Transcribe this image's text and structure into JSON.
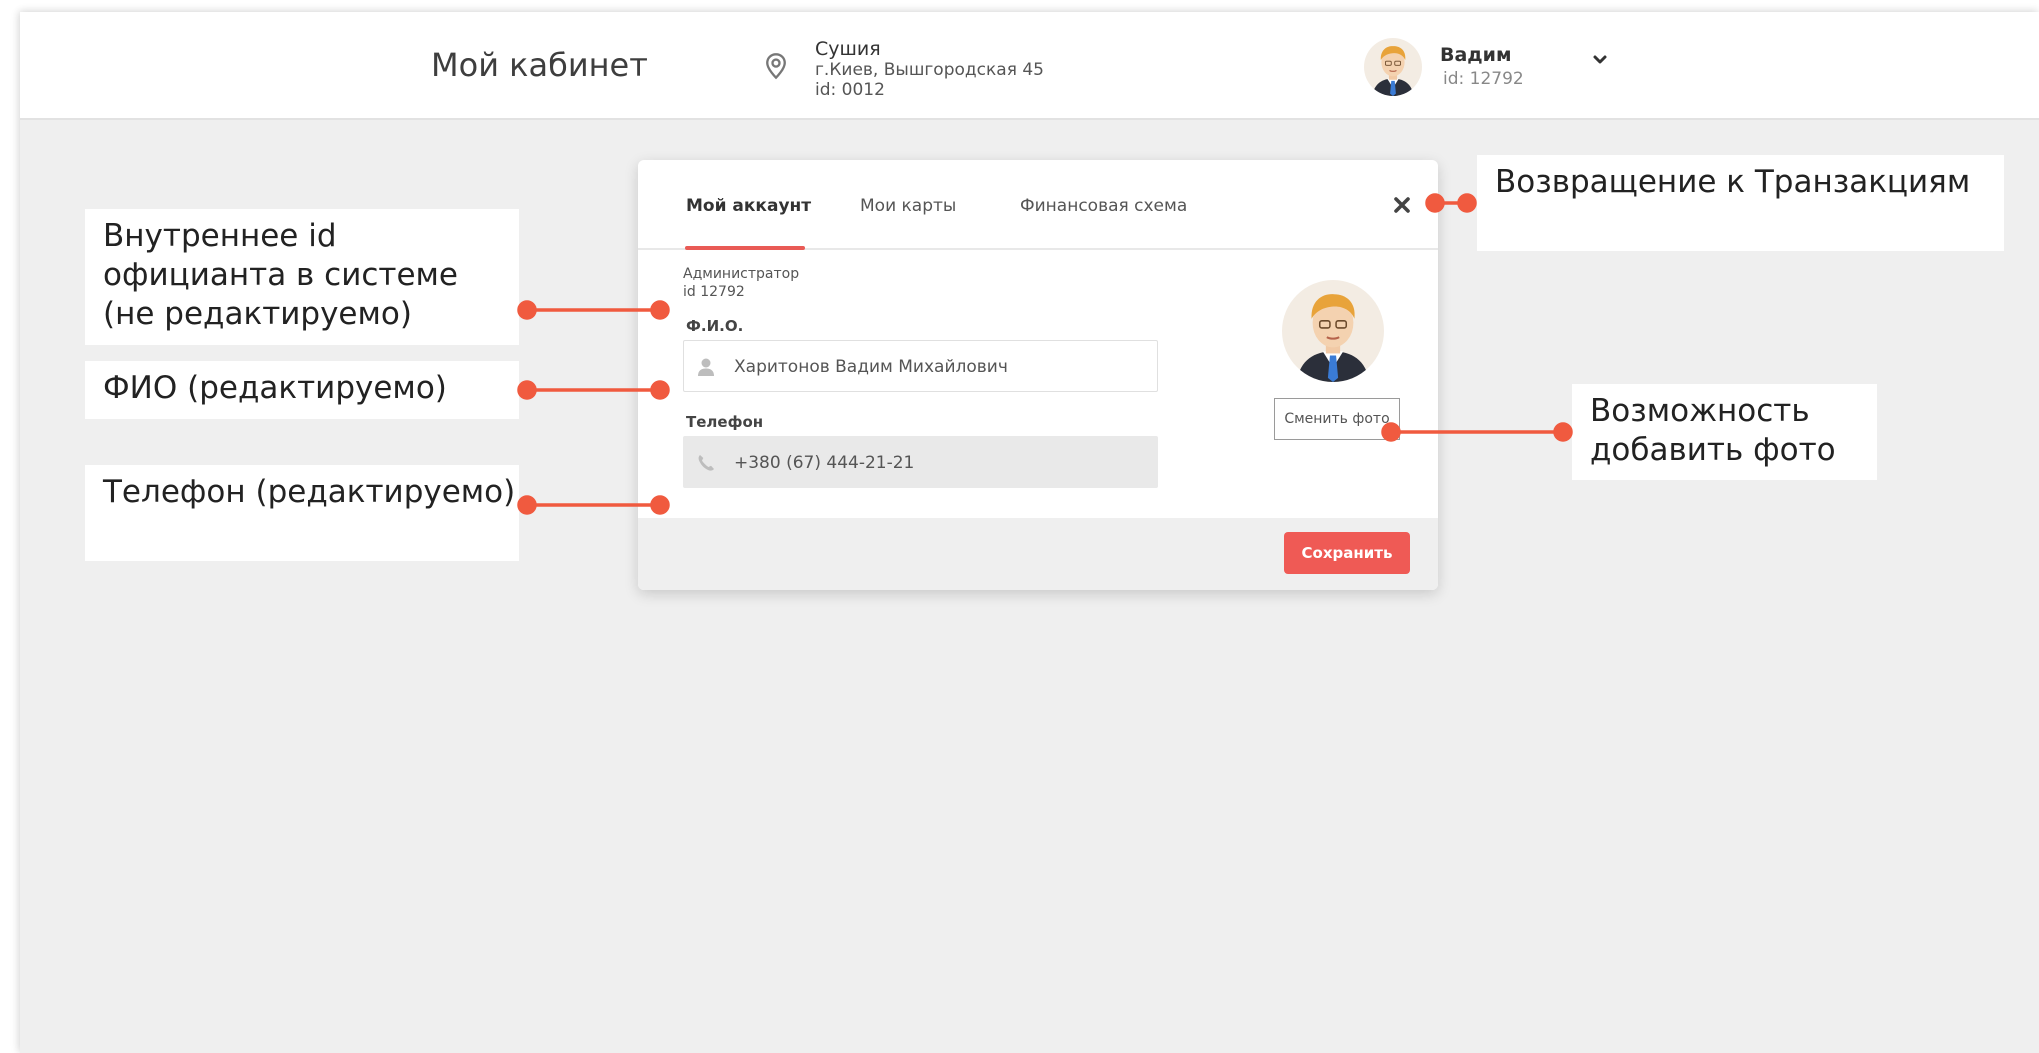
{
  "header": {
    "title": "Мой кабинет",
    "location": {
      "name": "Сушия",
      "address": "г.Киев, Вышгородская 45",
      "id": "id: 0012",
      "icon": "location-pin-icon"
    },
    "user": {
      "name": "Вадим",
      "id": "id: 12792",
      "menu_icon": "chevron-down-icon"
    }
  },
  "modal": {
    "tabs": [
      {
        "label": "Мой аккаунт",
        "active": true
      },
      {
        "label": "Мои карты",
        "active": false
      },
      {
        "label": "Финансовая схема",
        "active": false
      }
    ],
    "close_icon": "close-icon",
    "role": "Администратор",
    "role_id": "id 12792",
    "name_field": {
      "label": "Ф.И.О.",
      "value": "Харитонов Вадим Михайлович",
      "icon": "user-icon"
    },
    "phone_field": {
      "label": "Телефон",
      "value": "+380 (67) 444-21-21",
      "icon": "phone-icon"
    },
    "change_photo_label": "Сменить фото",
    "save_label": "Сохранить"
  },
  "annotations": {
    "internal_id": "Внутреннее id официанта в системе (не редактируемо)",
    "full_name": "ФИО (редактируемо)",
    "phone": "Телефон (редактируемо)",
    "back_to_transactions": "Возвращение к Транзакциям",
    "add_photo": "Возможность добавить фото"
  },
  "colors": {
    "accent": "#ef5a55",
    "callout_line": "#f05a3f",
    "background": "#efefef"
  }
}
